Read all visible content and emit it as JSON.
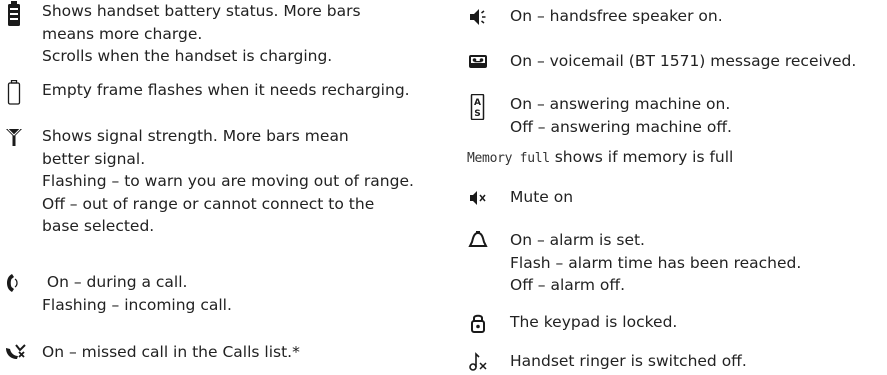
{
  "left_entries": [
    {
      "icon": "battery-full-icon",
      "lines": [
        "Shows handset battery status. More bars",
        "means more charge.",
        "Scrolls when the handset is charging."
      ]
    },
    {
      "icon": "battery-empty-icon",
      "lines": [
        "Empty frame flashes when it needs recharging."
      ]
    },
    {
      "icon": "signal-antenna-icon",
      "lines": [
        "Shows signal strength. More bars mean",
        "better signal.",
        "Flashing – to warn you are moving out of range.",
        "Off – out of range or cannot connect to the",
        "base selected."
      ]
    },
    {
      "icon": "handset-call-icon",
      "lines": [
        " On – during a call.",
        "Flashing – incoming call."
      ]
    },
    {
      "icon": "missed-call-icon",
      "lines": [
        "On – missed call in the Calls list.*"
      ]
    }
  ],
  "right_entries": [
    {
      "icon": "speaker-icon",
      "lines": [
        "On – handsfree speaker on."
      ]
    },
    {
      "icon": "voicemail-icon",
      "lines": [
        "On – voicemail (BT 1571) message received."
      ]
    },
    {
      "icon": "answering-machine-icon",
      "lines": [
        "On – answering machine on.",
        "Off – answering machine off."
      ]
    },
    {
      "icon": "mute-icon",
      "lines": [
        "Mute on"
      ]
    },
    {
      "icon": "alarm-bell-icon",
      "lines": [
        "On – alarm is set.",
        "Flash – alarm time has been reached.",
        "Off – alarm off."
      ]
    },
    {
      "icon": "keypad-lock-icon",
      "lines": [
        "The keypad is locked."
      ]
    },
    {
      "icon": "ringer-off-icon",
      "lines": [
        "Handset ringer is switched off."
      ]
    }
  ],
  "memory": {
    "display_text": "Memory full",
    "description": " shows if memory is full"
  },
  "colors": {
    "text": "#222222",
    "icon": "#1a1a1a"
  }
}
